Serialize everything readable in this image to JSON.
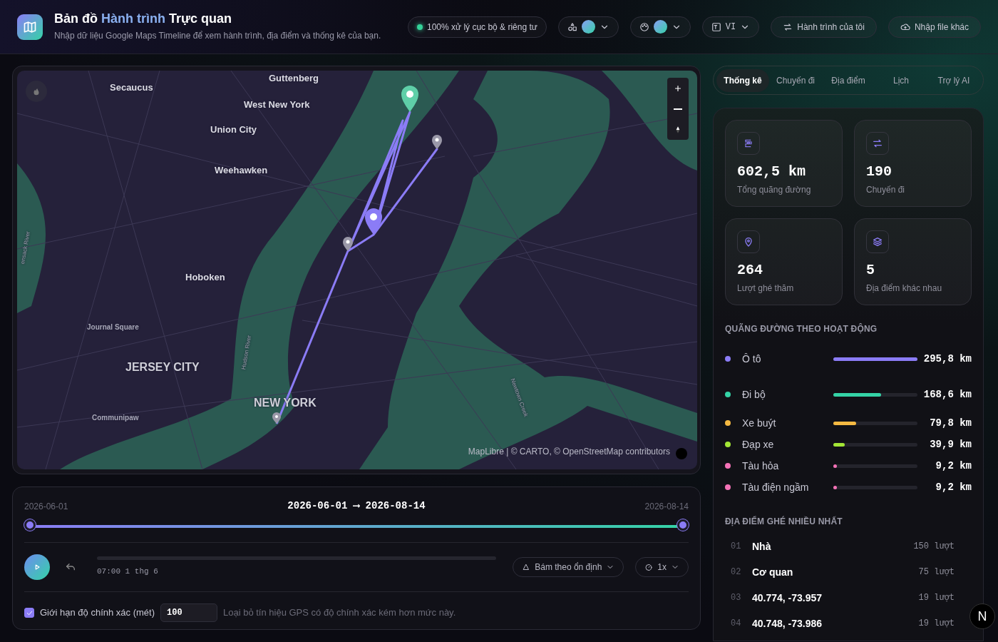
{
  "header": {
    "title": {
      "lead": "Bản đồ",
      "highlight": "Hành trình",
      "tail": "Trực quan"
    },
    "subtitle": "Nhập dữ liệu Google Maps Timeline để xem hành trình, địa điểm và thống kê của bạn.",
    "privacy": "100% xử lý cục bộ & riêng tư",
    "pickers": [
      {
        "kind": "shapes"
      },
      {
        "kind": "palette"
      }
    ],
    "language": "VI",
    "actions": [
      {
        "kind": "swap",
        "label": "Hành trình của tôi"
      },
      {
        "kind": "upload",
        "label": "Nhập file khác"
      }
    ]
  },
  "map": {
    "labels": [
      {
        "text": "Secaucus",
        "kind": "town"
      },
      {
        "text": "Guttenberg",
        "kind": "town"
      },
      {
        "text": "West New York",
        "kind": "town"
      },
      {
        "text": "Union City",
        "kind": "town"
      },
      {
        "text": "Weehawken",
        "kind": "town"
      },
      {
        "text": "Hoboken",
        "kind": "town"
      },
      {
        "text": "Journal Square",
        "kind": "minor"
      },
      {
        "text": "JERSEY CITY",
        "kind": "city"
      },
      {
        "text": "NEW YORK",
        "kind": "city"
      },
      {
        "text": "Communipaw",
        "kind": "minor"
      },
      {
        "text": "Hudson River",
        "kind": "river"
      },
      {
        "text": "Newtown Creek",
        "kind": "river"
      },
      {
        "text": "ensack River",
        "kind": "river"
      }
    ],
    "attribution": "MapLibre | © CARTO, © OpenStreetMap contributors"
  },
  "timeline": {
    "start": "2026-06-01",
    "range_from": "2026-06-01",
    "arrow": "⟶",
    "range_to": "2026-08-14",
    "end": "2026-08-14",
    "time": "07:00 1 thg 6",
    "follow_mode": "Bám theo ổn định",
    "speed": "1x",
    "accuracy": {
      "checked": true,
      "label": "Giới hạn độ chính xác (mét)",
      "value": "100",
      "hint": "Loại bỏ tín hiệu GPS có độ chính xác kém hơn mức này."
    }
  },
  "tabs": [
    {
      "label": "Thống kê",
      "selected": true
    },
    {
      "label": "Chuyến đi",
      "selected": false
    },
    {
      "label": "Địa điểm",
      "selected": false
    },
    {
      "label": "Lịch",
      "selected": false
    },
    {
      "label": "Trợ lý AI",
      "selected": false
    }
  ],
  "stats": [
    {
      "kind": "route",
      "value": "602,5 km",
      "label": "Tổng quãng đường"
    },
    {
      "kind": "swap",
      "value": "190",
      "label": "Chuyến đi"
    },
    {
      "kind": "pin",
      "value": "264",
      "label": "Lượt ghé thăm"
    },
    {
      "kind": "layers",
      "value": "5",
      "label": "Địa điểm khác nhau"
    }
  ],
  "activity_title": "QUÃNG ĐƯỜNG THEO HOẠT ĐỘNG",
  "activities": [
    {
      "name": "Ô tô",
      "color": "#8b7cf6",
      "level": 1,
      "reading": "295,8 km"
    },
    {
      "name": "Đi bộ",
      "color": "#34d3a6",
      "level": 0.57,
      "reading": "168,6 km"
    },
    {
      "name": "Xe buýt",
      "color": "#f5b942",
      "level": 0.27,
      "reading": "79,8 km"
    },
    {
      "name": "Đạp xe",
      "color": "#a3e635",
      "level": 0.135,
      "reading": "39,9 km"
    },
    {
      "name": "Tàu hỏa",
      "color": "#f472b6",
      "level": 0.03,
      "reading": "9,2 km"
    },
    {
      "name": "Tàu điện ngầm",
      "color": "#f472b6",
      "level": 0.03,
      "reading": "9,2 km"
    }
  ],
  "places_title": "ĐỊA ĐIỂM GHÉ NHIỀU NHẤT",
  "places": [
    {
      "rank": "01",
      "name": "Nhà",
      "count": "150 lượt"
    },
    {
      "rank": "02",
      "name": "Cơ quan",
      "count": "75 lượt"
    },
    {
      "rank": "03",
      "name": "40.774, -73.957",
      "count": "19 lượt"
    },
    {
      "rank": "04",
      "name": "40.748, -73.986",
      "count": "19 lượt"
    }
  ],
  "dev_badge": "N"
}
